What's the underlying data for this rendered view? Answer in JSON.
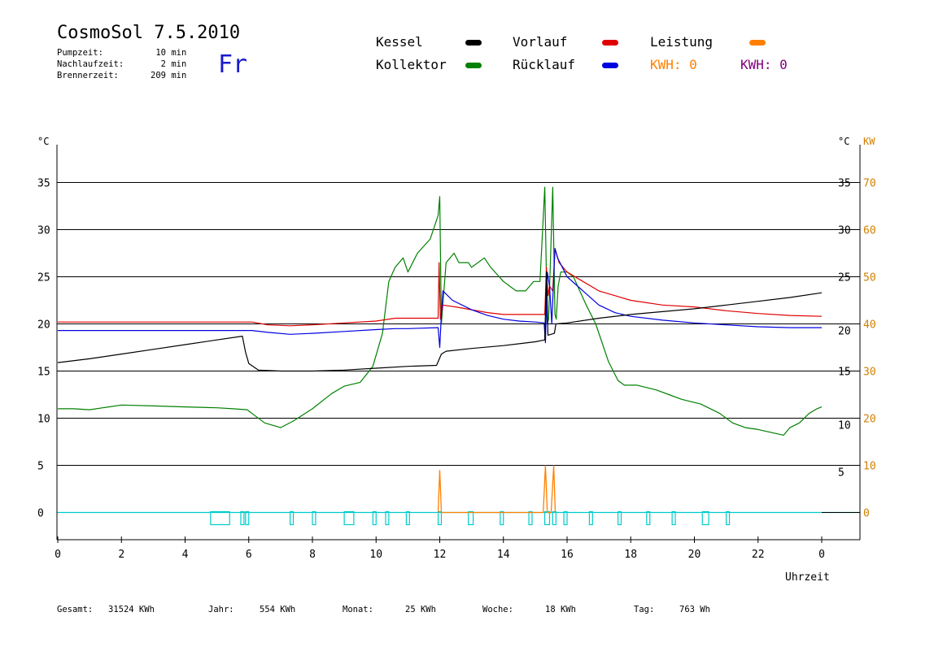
{
  "header": {
    "title": "CosmoSol 7.5.2010",
    "weekday": "Fr",
    "info": [
      {
        "label": "Pumpzeit:",
        "value": "10",
        "unit": "min"
      },
      {
        "label": "Nachlaufzeit:",
        "value": "2",
        "unit": "min"
      },
      {
        "label": "Brennerzeit:",
        "value": "209",
        "unit": "min"
      }
    ]
  },
  "legend": {
    "kessel": {
      "label": "Kessel",
      "color": "#000000"
    },
    "vorlauf": {
      "label": "Vorlauf",
      "color": "#e00000"
    },
    "leistung": {
      "label": "Leistung",
      "color": "#ff8000"
    },
    "kollektor": {
      "label": "Kollektor",
      "color": "#008000"
    },
    "ruecklauf": {
      "label": "Rücklauf",
      "color": "#0000e0"
    },
    "kwh_orange": "KWH: 0",
    "kwh_purple": "KWH: 0"
  },
  "footer": {
    "gesamt_label": "Gesamt:",
    "gesamt_value": "31524 KWh",
    "jahr_label": "Jahr:",
    "jahr_value": "554 KWh",
    "monat_label": "Monat:",
    "monat_value": "25 KWh",
    "woche_label": "Woche:",
    "woche_value": "18 KWh",
    "tag_label": "Tag:",
    "tag_value": "763 Wh"
  },
  "chart_data": [
    {
      "type": "line",
      "title": "",
      "xlabel": "Uhrzeit",
      "ylabel_left": "°C",
      "ylabel_right": "°C",
      "ylabel_right2": "KW",
      "xlim": [
        0,
        24
      ],
      "ylim": [
        -3,
        42
      ],
      "x_ticks": [
        0,
        2,
        4,
        6,
        8,
        10,
        12,
        14,
        16,
        18,
        20,
        22,
        24
      ],
      "x_tick_labels": [
        "0",
        "2",
        "4",
        "6",
        "8",
        "10",
        "12",
        "14",
        "16",
        "18",
        "20",
        "22",
        "0"
      ],
      "y_ticks_left": [
        0,
        5,
        10,
        15,
        20,
        25,
        30,
        35
      ],
      "y_ticks_right": [
        5,
        10,
        15,
        20,
        25,
        30,
        35
      ],
      "y_ticks_kw": [
        0,
        10,
        20,
        30,
        40,
        50,
        60,
        70
      ],
      "gridlines_y": [
        5,
        10,
        15,
        20,
        25,
        30,
        35
      ],
      "series": [
        {
          "name": "Kollektor",
          "color": "#008000",
          "x": [
            0,
            0.5,
            1,
            2,
            3,
            4,
            5,
            5.5,
            5.95,
            6.1,
            6.5,
            7.0,
            7.4,
            8.0,
            8.6,
            9.0,
            9.5,
            9.9,
            10.2,
            10.4,
            10.6,
            10.85,
            11.0,
            11.3,
            11.7,
            11.95,
            12.0,
            12.05,
            12.2,
            12.45,
            12.6,
            12.9,
            13.0,
            13.4,
            13.6,
            14.0,
            14.4,
            14.7,
            14.95,
            15.15,
            15.3,
            15.38,
            15.42,
            15.55,
            15.62,
            15.66,
            15.72,
            15.8,
            16.0,
            16.2,
            16.4,
            16.6,
            16.9,
            17.3,
            17.6,
            17.8,
            18.2,
            18.8,
            19.2,
            19.6,
            20.2,
            20.8,
            21.2,
            21.6,
            22.0,
            22.4,
            22.8,
            23.0,
            23.3,
            23.6,
            23.85,
            24.0
          ],
          "y": [
            11,
            11,
            10.9,
            11.4,
            11.3,
            11.2,
            11.1,
            11.0,
            10.9,
            10.5,
            9.5,
            9.0,
            9.7,
            11.0,
            12.6,
            13.4,
            13.8,
            15.5,
            19.0,
            24.5,
            26.0,
            27.0,
            25.5,
            27.5,
            29.0,
            31.5,
            33.5,
            20.0,
            26.5,
            27.5,
            26.5,
            26.5,
            26.0,
            27.0,
            26.0,
            24.5,
            23.5,
            23.5,
            24.5,
            24.5,
            34.5,
            20.0,
            20.5,
            34.5,
            21.0,
            20.5,
            24.0,
            25.5,
            25.5,
            25.0,
            23.5,
            22.0,
            20.0,
            16.0,
            14.0,
            13.5,
            13.5,
            13.0,
            12.5,
            12.0,
            11.5,
            10.5,
            9.5,
            9.0,
            8.8,
            8.5,
            8.2,
            9.0,
            9.5,
            10.5,
            11.0,
            11.2
          ]
        },
        {
          "name": "Vorlauf",
          "color": "#e00000",
          "x": [
            0,
            2,
            4,
            5.5,
            6.1,
            6.6,
            7.3,
            8.0,
            9.0,
            10.0,
            10.6,
            11.0,
            11.95,
            11.98,
            12.02,
            12.1,
            12.5,
            13.0,
            13.5,
            14.0,
            14.5,
            15.0,
            15.3,
            15.35,
            15.4,
            15.45,
            15.55,
            15.62,
            15.75,
            16.0,
            16.5,
            17.0,
            17.5,
            18.0,
            19.0,
            20.0,
            21.0,
            22.0,
            23.0,
            24.0
          ],
          "y": [
            20.2,
            20.2,
            20.2,
            20.2,
            20.2,
            19.9,
            19.8,
            19.9,
            20.1,
            20.3,
            20.6,
            20.6,
            20.6,
            26.5,
            20.5,
            22.0,
            21.8,
            21.5,
            21.2,
            21.0,
            21.0,
            21.0,
            21.0,
            26.0,
            23.0,
            24.0,
            23.5,
            28.0,
            26.5,
            25.5,
            24.5,
            23.5,
            23.0,
            22.5,
            22.0,
            21.8,
            21.4,
            21.1,
            20.9,
            20.8
          ]
        },
        {
          "name": "Rücklauf",
          "color": "#0000e0",
          "x": [
            0,
            2,
            4,
            5.5,
            6.1,
            6.6,
            7.3,
            8.0,
            9.0,
            10.0,
            10.6,
            11.0,
            11.95,
            12.0,
            12.05,
            12.1,
            12.4,
            13.0,
            13.5,
            14.0,
            14.5,
            15.0,
            15.28,
            15.32,
            15.38,
            15.45,
            15.52,
            15.62,
            15.7,
            16.0,
            16.5,
            17.0,
            17.5,
            18.0,
            19.0,
            20.0,
            21.0,
            22.0,
            23.0,
            24.0
          ],
          "y": [
            19.3,
            19.3,
            19.3,
            19.3,
            19.3,
            19.1,
            18.9,
            19.0,
            19.2,
            19.4,
            19.5,
            19.5,
            19.6,
            17.5,
            21.0,
            23.5,
            22.5,
            21.5,
            20.9,
            20.5,
            20.3,
            20.2,
            20.1,
            18.0,
            25.5,
            24.0,
            20.0,
            28.0,
            27.0,
            25.0,
            23.5,
            22.0,
            21.2,
            20.8,
            20.4,
            20.1,
            19.9,
            19.7,
            19.6,
            19.6
          ]
        },
        {
          "name": "Kessel",
          "color": "#000000",
          "x": [
            0,
            1,
            2,
            3,
            4,
            5,
            5.8,
            5.9,
            6.0,
            6.3,
            7.0,
            8.0,
            9.0,
            10.0,
            11.0,
            11.9,
            12.05,
            12.2,
            13.0,
            14.0,
            15.0,
            15.3,
            15.35,
            15.4,
            15.6,
            15.65,
            16.0,
            17.0,
            18.0,
            19.0,
            20.0,
            21.0,
            22.0,
            23.0,
            24.0
          ],
          "y": [
            15.9,
            16.3,
            16.8,
            17.3,
            17.8,
            18.3,
            18.7,
            17.0,
            15.8,
            15.1,
            15.0,
            15.0,
            15.1,
            15.3,
            15.5,
            15.6,
            16.8,
            17.1,
            17.4,
            17.7,
            18.1,
            18.3,
            25.5,
            18.8,
            19.0,
            20.0,
            20.1,
            20.6,
            21.0,
            21.3,
            21.6,
            22.0,
            22.4,
            22.8,
            23.3
          ]
        }
      ]
    },
    {
      "type": "line",
      "title": "Leistung",
      "xlim": [
        0,
        24
      ],
      "series": [
        {
          "name": "Leistung",
          "color": "#ff8000",
          "x": [
            11.95,
            12.0,
            12.05,
            15.25,
            15.32,
            15.38,
            15.5,
            15.58,
            15.63
          ],
          "y": [
            0,
            9,
            0,
            0,
            10,
            0,
            0,
            10,
            0
          ]
        },
        {
          "name": "Pumpe",
          "color": "#00cccc",
          "intervals": [
            [
              4.8,
              5.4
            ],
            [
              5.75,
              5.85
            ],
            [
              5.9,
              6.0
            ],
            [
              7.3,
              7.4
            ],
            [
              8.0,
              8.1
            ],
            [
              9.0,
              9.3
            ],
            [
              9.9,
              10.0
            ],
            [
              10.3,
              10.4
            ],
            [
              10.95,
              11.05
            ],
            [
              11.95,
              12.05
            ],
            [
              12.9,
              13.05
            ],
            [
              13.9,
              14.0
            ],
            [
              14.8,
              14.9
            ],
            [
              15.3,
              15.45
            ],
            [
              15.55,
              15.65
            ],
            [
              15.9,
              16.0
            ],
            [
              16.7,
              16.8
            ],
            [
              17.6,
              17.7
            ],
            [
              18.5,
              18.6
            ],
            [
              19.3,
              19.4
            ],
            [
              20.25,
              20.45
            ],
            [
              21.0,
              21.1
            ]
          ]
        }
      ]
    }
  ]
}
